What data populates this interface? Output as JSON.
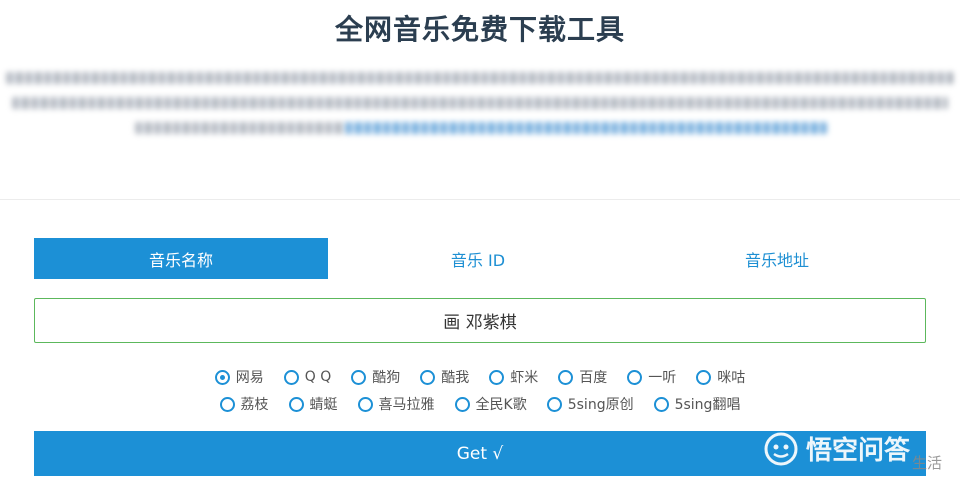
{
  "page": {
    "title": "全网音乐免费下载工具"
  },
  "tabs": [
    {
      "label": "音乐名称",
      "active": true
    },
    {
      "label": "音乐 ID",
      "active": false
    },
    {
      "label": "音乐地址",
      "active": false
    }
  ],
  "search": {
    "value": "画 邓紫棋"
  },
  "sources_row1": [
    {
      "label": "网易",
      "checked": true
    },
    {
      "label": "Q Q",
      "checked": false
    },
    {
      "label": "酷狗",
      "checked": false
    },
    {
      "label": "酷我",
      "checked": false
    },
    {
      "label": "虾米",
      "checked": false
    },
    {
      "label": "百度",
      "checked": false
    },
    {
      "label": "一听",
      "checked": false
    },
    {
      "label": "咪咕",
      "checked": false
    }
  ],
  "sources_row2": [
    {
      "label": "荔枝",
      "checked": false
    },
    {
      "label": "蜻蜓",
      "checked": false
    },
    {
      "label": "喜马拉雅",
      "checked": false
    },
    {
      "label": "全民K歌",
      "checked": false
    },
    {
      "label": "5sing原创",
      "checked": false
    },
    {
      "label": "5sing翻唱",
      "checked": false
    }
  ],
  "get_button": {
    "label": "Get √"
  },
  "watermark": {
    "text": "悟空问答",
    "tail": "生活"
  },
  "colors": {
    "accent": "#1c90d6",
    "search_border": "#5cb85c",
    "title": "#2b3e50"
  }
}
